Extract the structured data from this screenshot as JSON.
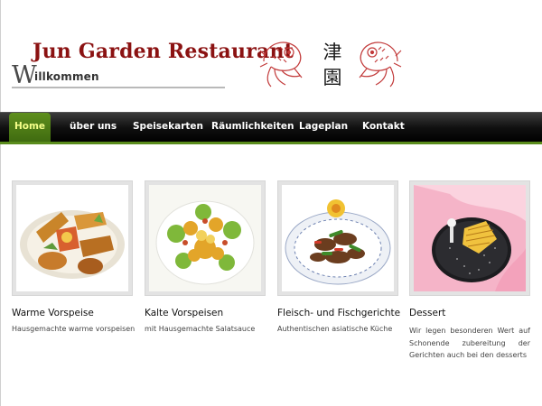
{
  "header": {
    "title": "Jun Garden Restaurant",
    "welcome_initial": "W",
    "welcome_rest": "illkommen",
    "chinese_chars": [
      "津",
      "園"
    ]
  },
  "nav": {
    "items": [
      {
        "label": "Home",
        "active": true
      },
      {
        "label": "über uns"
      },
      {
        "label": "Speisekarten"
      },
      {
        "label": "Räumlichkeiten"
      },
      {
        "label": "Lageplan"
      },
      {
        "label": "Kontakt"
      }
    ]
  },
  "cards": [
    {
      "title": "Warme Vorspeise",
      "desc": "Hausgemachte warme vorspeisen"
    },
    {
      "title": "Kalte Vorspeisen",
      "desc": "mit Hausgemachte Salatsauce"
    },
    {
      "title": "Fleisch- und Fischgerichte",
      "desc": "Authentischen asiatische Küche"
    },
    {
      "title": "Dessert",
      "desc": "Wir legen besonderen Wert auf Schonende zubereitung der Gerichten auch bei den desserts"
    }
  ],
  "colors": {
    "title": "#8b1212",
    "nav_active": "#4f7e17",
    "nav_active_text": "#f6ff8a",
    "nav_bg": "#000000",
    "accent_line": "#5a8c1c"
  }
}
